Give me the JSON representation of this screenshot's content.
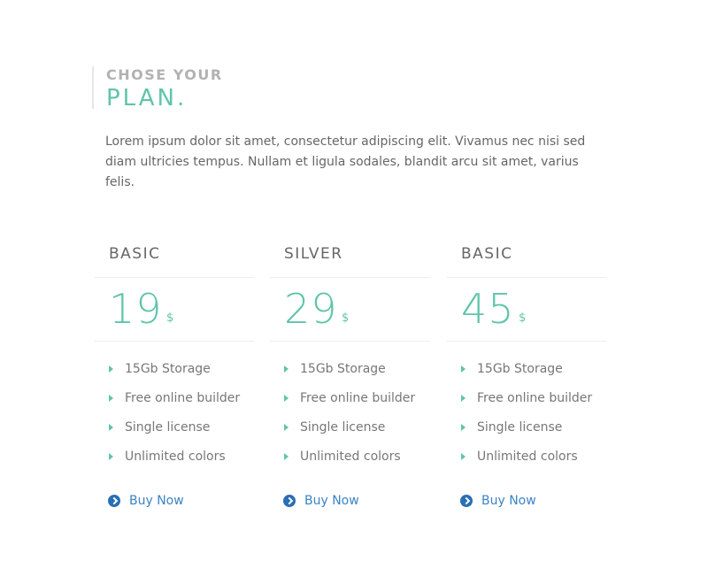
{
  "header": {
    "kicker": "CHOSE YOUR",
    "title": "PLAN."
  },
  "intro": "Lorem ipsum dolor sit amet, consectetur adipiscing elit. Vivamus nec nisi sed diam ultricies tempus. Nullam et ligula sodales, blandit arcu sit amet, varius felis.",
  "plans": [
    {
      "name": "BASIC",
      "price": "19",
      "currency": "$",
      "features": [
        "15Gb Storage",
        "Free online builder",
        "Single license",
        "Unlimited colors"
      ],
      "cta": "Buy Now"
    },
    {
      "name": "SILVER",
      "price": "29",
      "currency": "$",
      "features": [
        "15Gb Storage",
        "Free online builder",
        "Single license",
        "Unlimited colors"
      ],
      "cta": "Buy Now"
    },
    {
      "name": "BASIC",
      "price": "45",
      "currency": "$",
      "features": [
        "15Gb Storage",
        "Free online builder",
        "Single license",
        "Unlimited colors"
      ],
      "cta": "Buy Now"
    }
  ],
  "colors": {
    "accent": "#5fc4ab",
    "link": "#3b83c6",
    "icon": "#2a6fb3",
    "muted": "#b2b2b2"
  },
  "icons": {
    "feature_bullet": "caret-right-icon",
    "cta": "chevron-circle-right-icon"
  }
}
